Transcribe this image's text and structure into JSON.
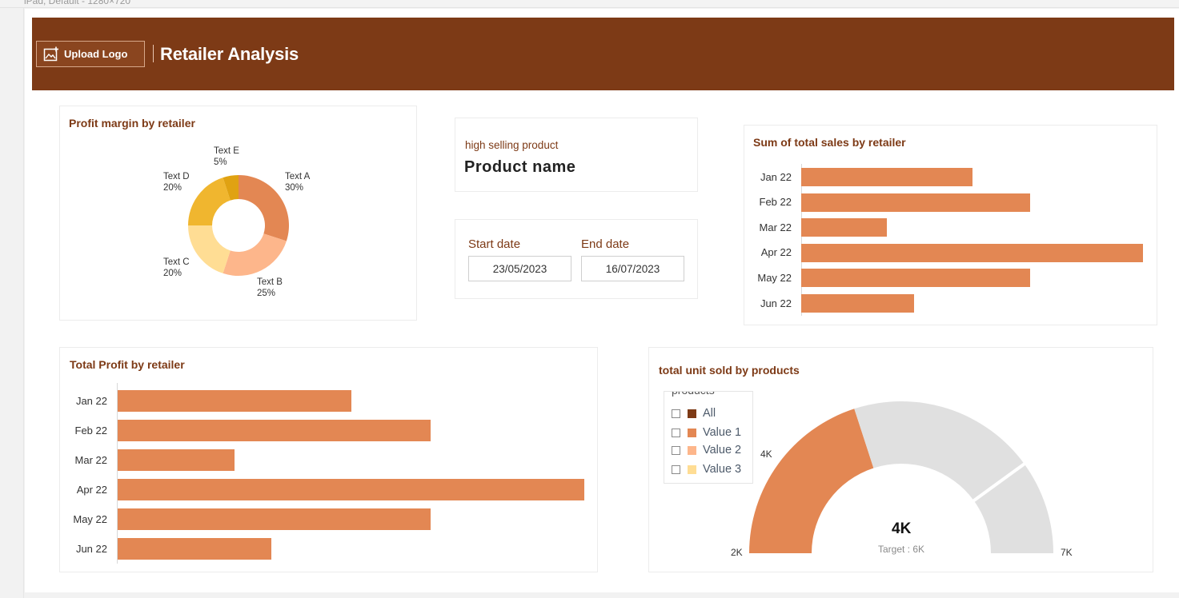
{
  "window": {
    "breadcrumb": "iPad, Default - 1280×720"
  },
  "header": {
    "upload_label": "Upload Logo",
    "title": "Retailer Analysis",
    "background": "#7d3a16"
  },
  "profit_margin": {
    "title": "Profit margin by retailer",
    "chart_data": {
      "type": "pie",
      "donut": true,
      "slices": [
        {
          "label": "Text A",
          "value": 30,
          "display": "30%",
          "color": "#e38753"
        },
        {
          "label": "Text B",
          "value": 25,
          "display": "25%",
          "color": "#fdb68b"
        },
        {
          "label": "Text C",
          "value": 20,
          "display": "20%",
          "color": "#ffdd94"
        },
        {
          "label": "Text D",
          "value": 20,
          "display": "20%",
          "color": "#f0b62f"
        },
        {
          "label": "Text E",
          "value": 5,
          "display": "5%",
          "color": "#e0a212"
        }
      ]
    }
  },
  "kpi": {
    "subtitle": "high selling product",
    "value": "Product name"
  },
  "dates": {
    "start_label": "Start date",
    "start_value": "23/05/2023",
    "end_label": "End date",
    "end_value": "16/07/2023"
  },
  "sales": {
    "title": "Sum of total sales by retailer",
    "chart_data": {
      "type": "bar",
      "orientation": "horizontal",
      "categories": [
        "Jan 22",
        "Feb 22",
        "Mar 22",
        "Apr 22",
        "May 22",
        "Jun 22"
      ],
      "values": [
        50,
        67,
        25,
        100,
        67,
        33
      ],
      "xlim": [
        0,
        100
      ],
      "color": "#e38753"
    }
  },
  "profit": {
    "title": "Total Profit by retailer",
    "chart_data": {
      "type": "bar",
      "orientation": "horizontal",
      "categories": [
        "Jan 22",
        "Feb 22",
        "Mar 22",
        "Apr 22",
        "May 22",
        "Jun 22"
      ],
      "values": [
        50,
        67,
        25,
        100,
        67,
        33
      ],
      "xlim": [
        0,
        100
      ],
      "color": "#e38753"
    }
  },
  "units": {
    "title": "total unit sold by products",
    "legend": {
      "title": "products",
      "items": [
        {
          "label": "All",
          "color": "#7d3a16"
        },
        {
          "label": "Value 1",
          "color": "#e38753"
        },
        {
          "label": "Value 2",
          "color": "#fdb68b"
        },
        {
          "label": "Value 3",
          "color": "#ffdd94"
        }
      ]
    },
    "chart_data": {
      "type": "gauge",
      "min": 2000,
      "max": 7000,
      "value": 4000,
      "target": 6000,
      "labels": {
        "min": "2K",
        "max": "7K",
        "value_mark": "4K",
        "center": "4K",
        "target": "Target : 6K"
      },
      "fill_color": "#e38753",
      "track_color": "#e0e0e0"
    }
  }
}
